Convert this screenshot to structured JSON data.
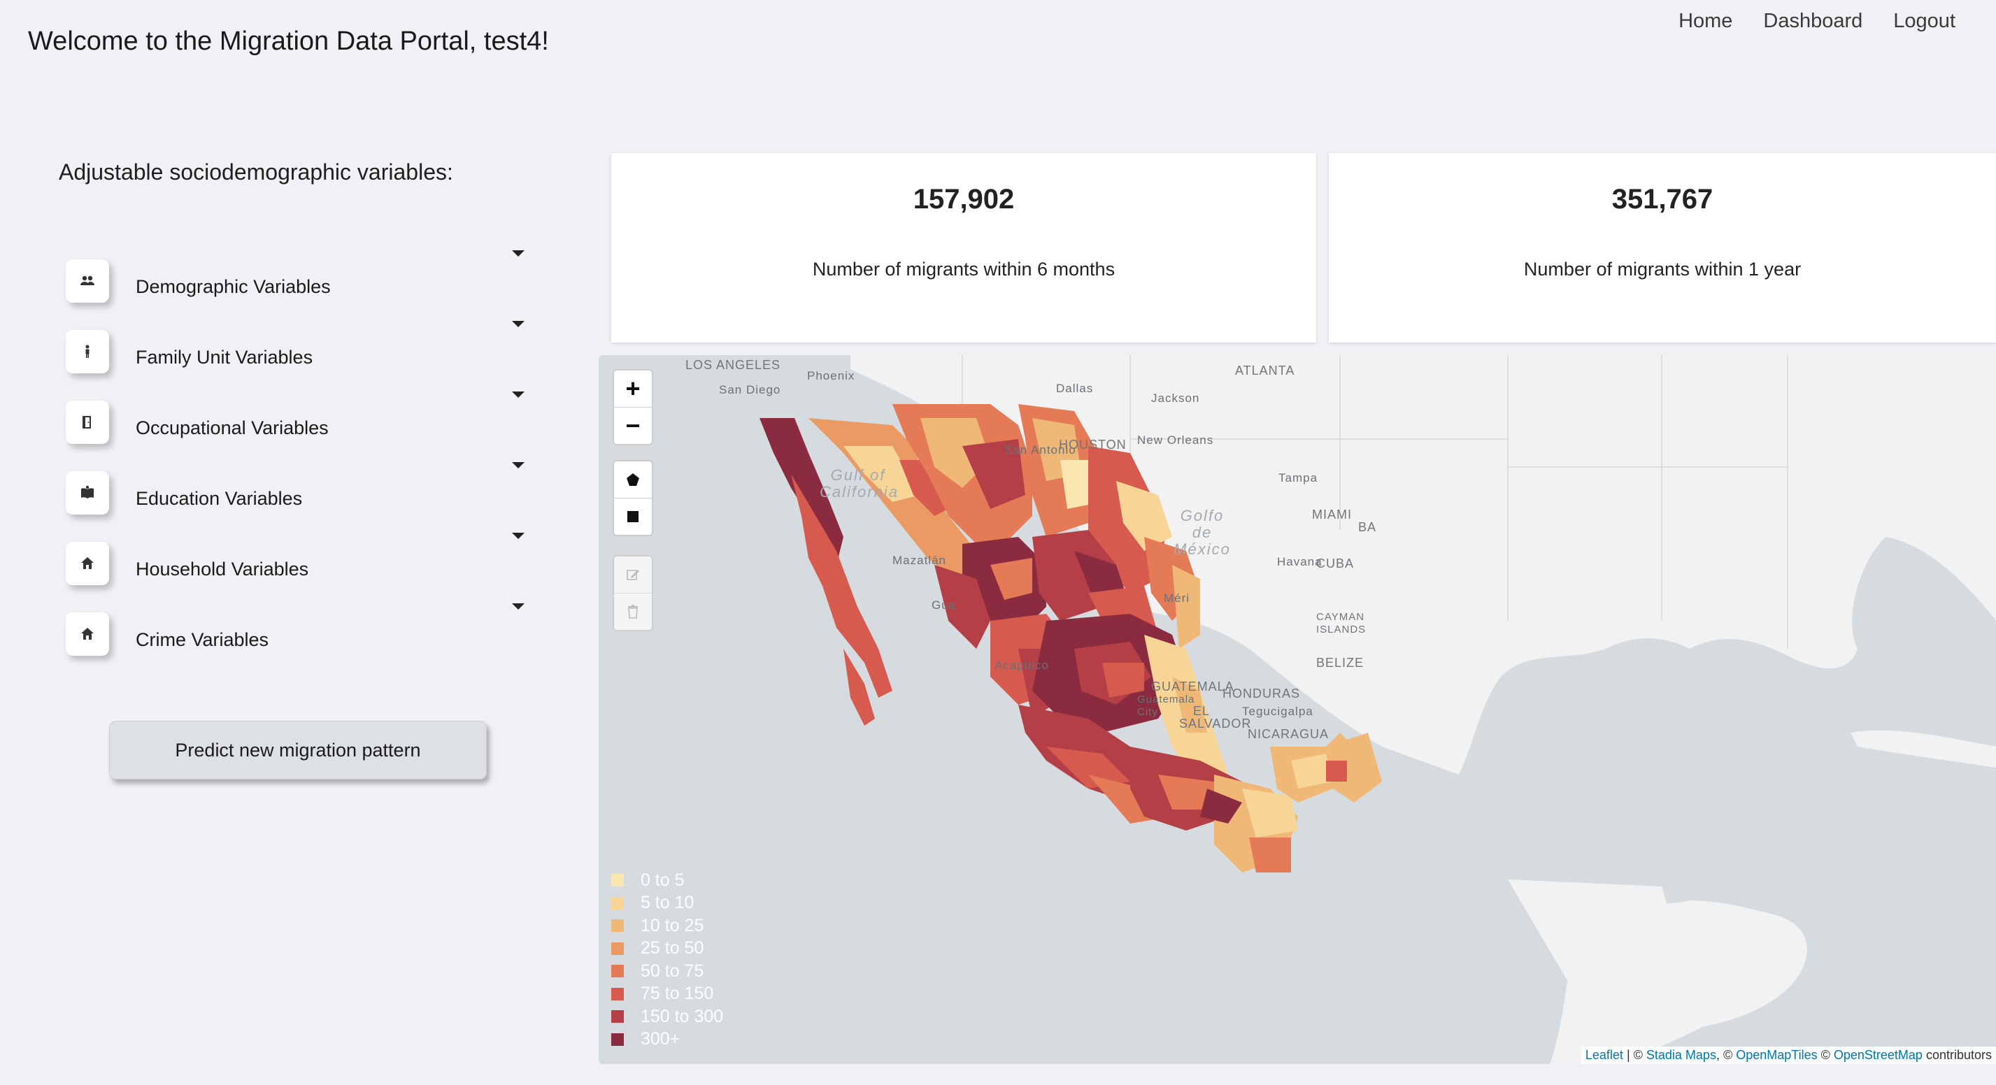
{
  "header": {
    "welcome": "Welcome to the Migration Data Portal, test4!",
    "nav": {
      "home": "Home",
      "dashboard": "Dashboard",
      "logout": "Logout"
    }
  },
  "sidebar": {
    "title": "Adjustable sociodemographic variables:",
    "items": [
      {
        "label": "Demographic Variables",
        "icon": "people-icon"
      },
      {
        "label": "Family Unit Variables",
        "icon": "person-icon"
      },
      {
        "label": "Occupational Variables",
        "icon": "door-icon"
      },
      {
        "label": "Education Variables",
        "icon": "book-icon"
      },
      {
        "label": "Household Variables",
        "icon": "home-icon"
      },
      {
        "label": "Crime Variables",
        "icon": "home-icon"
      }
    ],
    "predict_button": "Predict new migration pattern"
  },
  "stats": [
    {
      "value": "157,902",
      "label": "Number of migrants within 6 months"
    },
    {
      "value": "351,767",
      "label": "Number of migrants within 1 year"
    }
  ],
  "map": {
    "zoom_in": "+",
    "zoom_out": "−",
    "places": {
      "los_angeles": "LOS ANGELES",
      "san_diego": "San Diego",
      "phoenix": "Phoenix",
      "dallas": "Dallas",
      "jackson": "Jackson",
      "atlanta": "ATLANTA",
      "san_antonio": "San Antonio",
      "houston": "HOUSTON",
      "new_orleans": "New Orleans",
      "tampa": "Tampa",
      "miami": "MIAMI",
      "havana": "Havana",
      "cuba": "CUBA",
      "cayman": "CAYMAN ISLANDS",
      "mazatlan": "Mazatlán",
      "acapulco": "Acapulco",
      "merida": "Méri",
      "belize": "BELIZE",
      "guatemala": "GUATEMALA",
      "guatemala_city": "Guatemala City",
      "honduras": "HONDURAS",
      "tegucigalpa": "Tegucigalpa",
      "el_salvador": "EL SALVADOR",
      "nicaragua": "NICARAGUA",
      "gulf_california": "Gulf of California",
      "golfo_mexico": "Golfo de México",
      "gua": "Gua",
      "bahamas_edge": "BA"
    },
    "legend": [
      {
        "label": "0 to 5",
        "color": "#f9e6b0"
      },
      {
        "label": "5 to 10",
        "color": "#f7d596"
      },
      {
        "label": "10 to 25",
        "color": "#f0b877"
      },
      {
        "label": "25 to 50",
        "color": "#eb9a64"
      },
      {
        "label": "50 to 75",
        "color": "#e47a56"
      },
      {
        "label": "75 to 150",
        "color": "#d65a4d"
      },
      {
        "label": "150 to 300",
        "color": "#b53f47"
      },
      {
        "label": "300+",
        "color": "#8b2b40"
      }
    ],
    "attribution": {
      "leaflet": "Leaflet",
      "sep1": " | © ",
      "stadia": "Stadia Maps",
      "sep2": ", © ",
      "omt": "OpenMapTiles",
      "sep3": " © ",
      "osm": "OpenStreetMap",
      "tail": " contributors"
    }
  }
}
